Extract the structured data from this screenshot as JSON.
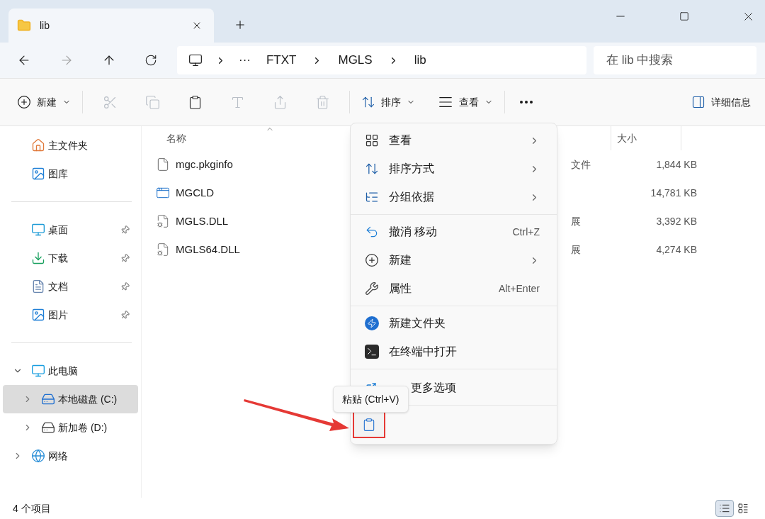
{
  "tabs": [
    {
      "title": "lib",
      "selected": true
    }
  ],
  "address": {
    "path": [
      "FTXT",
      "MGLS",
      "lib"
    ],
    "overflow": "···"
  },
  "search": {
    "placeholder": "在 lib 中搜索"
  },
  "toolbar": {
    "items": [
      {
        "kind": "new",
        "label": "新建",
        "disabled": false
      },
      {
        "kind": "cut",
        "disabled": true
      },
      {
        "kind": "copy",
        "disabled": true
      },
      {
        "kind": "paste",
        "disabled": false
      },
      {
        "kind": "rename",
        "disabled": true
      },
      {
        "kind": "share",
        "disabled": true
      },
      {
        "kind": "delete",
        "disabled": true
      },
      {
        "kind": "sort",
        "label": "排序",
        "disabled": false
      },
      {
        "kind": "view",
        "label": "查看",
        "disabled": false
      },
      {
        "kind": "more",
        "disabled": false
      }
    ],
    "details": "详细信息"
  },
  "sidebar": {
    "groups": [
      [
        {
          "kind": "home",
          "label": "主文件夹",
          "pinned": false,
          "selected": false
        },
        {
          "kind": "gallery",
          "label": "图库",
          "pinned": false,
          "selected": false
        }
      ],
      [
        {
          "kind": "desktop",
          "label": "桌面",
          "pinned": true,
          "selected": false
        },
        {
          "kind": "downloads",
          "label": "下载",
          "pinned": true,
          "selected": false
        },
        {
          "kind": "documents",
          "label": "文档",
          "pinned": true,
          "selected": false
        },
        {
          "kind": "pictures",
          "label": "图片",
          "pinned": true,
          "selected": false
        }
      ],
      [
        {
          "kind": "pc",
          "label": "此电脑",
          "expanded": true,
          "selected": false,
          "children": [
            {
              "kind": "disk-c",
              "label": "本地磁盘 (C:)",
              "expanded": false,
              "selected": true
            },
            {
              "kind": "disk-d",
              "label": "新加卷 (D:)",
              "expanded": false,
              "selected": false
            }
          ]
        },
        {
          "kind": "network",
          "label": "网络",
          "expanded": false,
          "selected": false
        }
      ]
    ]
  },
  "table": {
    "columns": [
      "名称",
      "大小"
    ],
    "rows": [
      {
        "kind": "file",
        "name": "mgc.pkginfo",
        "type": "文件",
        "size": "1,844 KB"
      },
      {
        "kind": "app",
        "name": "MGCLD",
        "size": "14,781 KB"
      },
      {
        "kind": "dll",
        "name": "MGLS.DLL",
        "type": "展",
        "size": "3,392 KB"
      },
      {
        "kind": "dll",
        "name": "MGLS64.DLL",
        "type": "展",
        "size": "4,274 KB"
      }
    ]
  },
  "context_menu": {
    "groups": [
      [
        {
          "kind": "view",
          "label": "查看",
          "submenu": true
        },
        {
          "kind": "sort",
          "label": "排序方式",
          "submenu": true
        },
        {
          "kind": "group",
          "label": "分组依据",
          "submenu": true
        }
      ],
      [
        {
          "kind": "undo",
          "label": "撤消 移动",
          "shortcut": "Ctrl+Z"
        },
        {
          "kind": "new",
          "label": "新建",
          "submenu": true
        },
        {
          "kind": "properties",
          "label": "属性",
          "shortcut": "Alt+Enter"
        }
      ],
      [
        {
          "kind": "new-folder",
          "label": "新建文件夹"
        },
        {
          "kind": "terminal",
          "label": "在终端中打开"
        }
      ],
      [
        {
          "kind": "more-options",
          "label": "更多选项"
        }
      ]
    ],
    "actions": [
      {
        "kind": "paste",
        "tooltip": "粘贴 (Ctrl+V)"
      }
    ]
  },
  "status_bar": {
    "count": "4 个项目",
    "views": [
      {
        "kind": "details",
        "selected": true
      },
      {
        "kind": "tiles",
        "selected": false
      }
    ]
  }
}
